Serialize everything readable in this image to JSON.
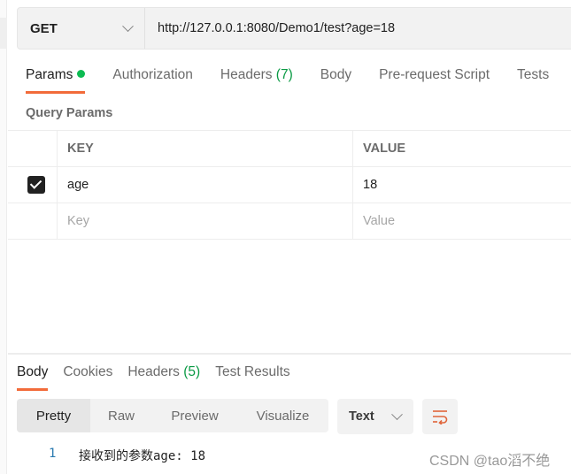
{
  "request": {
    "method": "GET",
    "url": "http://127.0.0.1:8080/Demo1/test?age=18"
  },
  "request_tabs": [
    {
      "label": "Params",
      "active": true,
      "indicator": "green-dot"
    },
    {
      "label": "Authorization"
    },
    {
      "label": "Headers",
      "count": "(7)"
    },
    {
      "label": "Body"
    },
    {
      "label": "Pre-request Script"
    },
    {
      "label": "Tests"
    }
  ],
  "query_params": {
    "title": "Query Params",
    "columns": [
      "KEY",
      "VALUE"
    ],
    "rows": [
      {
        "checked": true,
        "key": "age",
        "value": "18"
      }
    ],
    "new_row": {
      "key_placeholder": "Key",
      "value_placeholder": "Value"
    }
  },
  "response_tabs": [
    {
      "label": "Body",
      "active": true
    },
    {
      "label": "Cookies"
    },
    {
      "label": "Headers",
      "count": "(5)"
    },
    {
      "label": "Test Results"
    }
  ],
  "view_modes": [
    "Pretty",
    "Raw",
    "Preview",
    "Visualize"
  ],
  "active_view": "Pretty",
  "format": "Text",
  "response_body": [
    {
      "line": "1",
      "text": "接收到的参数age: 18"
    }
  ],
  "watermark": "CSDN @tao滔不绝",
  "colors": {
    "accent": "#f26b3a",
    "success": "#0cbb52"
  }
}
